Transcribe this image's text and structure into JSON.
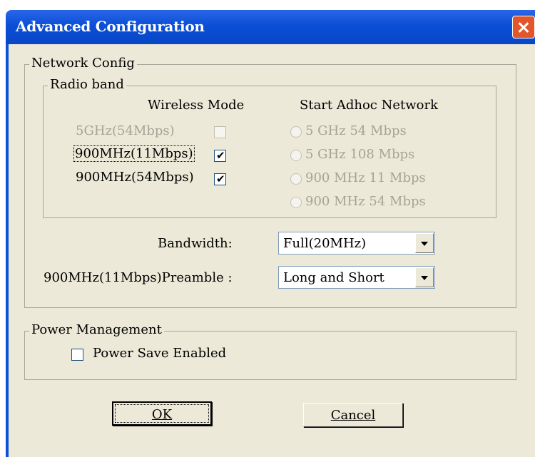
{
  "window": {
    "title": "Advanced Configuration"
  },
  "network_config": {
    "legend": "Network Config",
    "radio_band": {
      "legend": "Radio band",
      "wireless_mode_header": "Wireless Mode",
      "adhoc_header": "Start Adhoc Network",
      "modes": [
        {
          "label": "5GHz(54Mbps)",
          "checked": false,
          "enabled": false
        },
        {
          "label": "900MHz(11Mbps)",
          "checked": true,
          "enabled": true
        },
        {
          "label": "900MHz(54Mbps)",
          "checked": true,
          "enabled": true
        }
      ],
      "adhoc_options": [
        {
          "label": "5 GHz 54 Mbps",
          "enabled": false
        },
        {
          "label": "5 GHz 108 Mbps",
          "enabled": false
        },
        {
          "label": "900 MHz 11 Mbps",
          "enabled": false
        },
        {
          "label": "900 MHz 54 Mbps",
          "enabled": false
        }
      ]
    },
    "bandwidth": {
      "label": "Bandwidth:",
      "value": "Full(20MHz)"
    },
    "preamble": {
      "label": "900MHz(11Mbps)Preamble :",
      "value": "Long and Short"
    }
  },
  "power_management": {
    "legend": "Power Management",
    "power_save_label": "Power Save Enabled",
    "power_save_checked": false
  },
  "buttons": {
    "ok": "OK",
    "cancel": "Cancel"
  }
}
